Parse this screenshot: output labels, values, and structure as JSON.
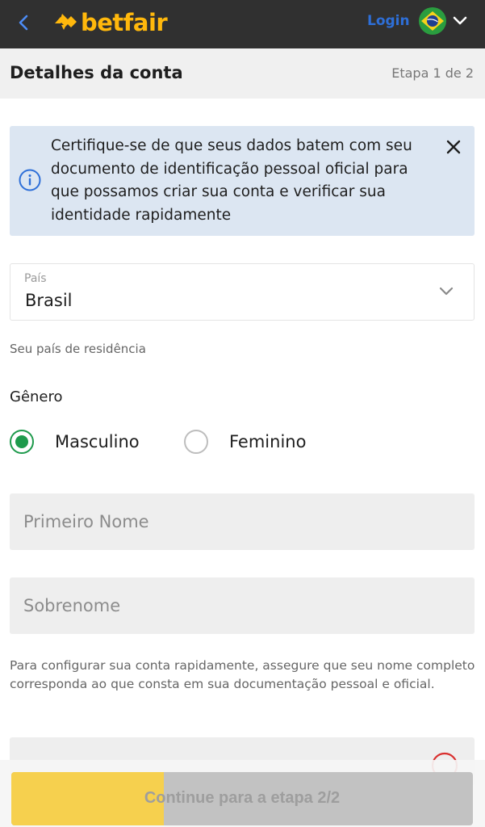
{
  "header": {
    "brand": "betfair",
    "login_label": "Login",
    "flag": "brazil-flag-icon"
  },
  "step": {
    "title": "Detalhes da conta",
    "indicator": "Etapa 1 de 2"
  },
  "info_banner": {
    "text": "Certifique-se de que seus dados batem com seu documento de identificação pessoal oficial para que possamos criar sua conta e verificar sua identidade rapidamente"
  },
  "country": {
    "label": "País",
    "value": "Brasil",
    "help": "Seu país de residência"
  },
  "gender": {
    "label": "Gênero",
    "options": [
      {
        "label": "Masculino",
        "selected": true
      },
      {
        "label": "Feminino",
        "selected": false
      }
    ]
  },
  "name_fields": {
    "first_placeholder": "Primeiro Nome",
    "last_placeholder": "Sobrenome",
    "help": "Para configurar sua conta rapidamente, assegure que seu nome completo corresponda ao que consta em sua documentação pessoal e oficial."
  },
  "continue_button": {
    "label": "Continue para a etapa 2/2",
    "progress": 0.33
  },
  "colors": {
    "brand_yellow": "#ffb80c",
    "link_blue": "#2e6fd8",
    "success_green": "#1e9a4c",
    "banner_bg": "#dce6f2",
    "progress_yellow": "#f6d04e"
  }
}
